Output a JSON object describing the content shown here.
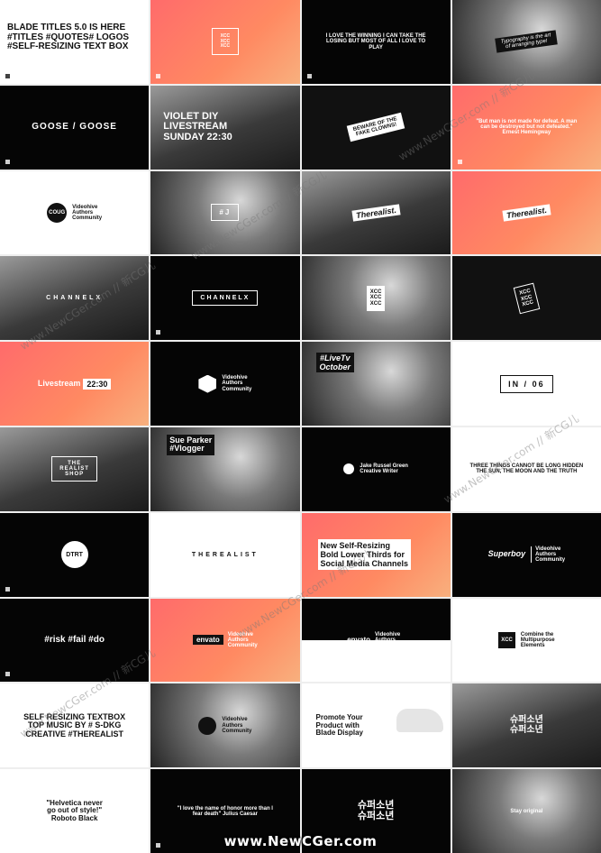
{
  "tiles": [
    {
      "text": "BLADE TITLES 5.0 IS HERE\n#TITLES #QUOTES# LOGOS\n#SELF-RESIZING TEXT BOX"
    },
    {
      "text": "XCC\nXCC\nXCC"
    },
    {
      "text": "I LOVE THE WINNING I CAN TAKE THE LOSING BUT MOST OF ALL I LOVE TO PLAY"
    },
    {
      "text": "Typography is the art of arranging type!"
    },
    {
      "text": "GOOSE / GOOSE"
    },
    {
      "text": "VIOLET DIY\nLIVESTREAM\nSUNDAY 22:30"
    },
    {
      "text": "BEWARE OF THE\nFAKE CLOWNS!"
    },
    {
      "text": "\"But man is not made for defeat. A man can be destroyed but not defeated.\" Ernest Hemingway"
    },
    {
      "logo": "COUG",
      "text": "Videohive\nAuthors\nCommunity"
    },
    {
      "text": "#J"
    },
    {
      "text": "Therealist."
    },
    {
      "text": "Therealist."
    },
    {
      "text": "CHANNELX"
    },
    {
      "text": "CHANNELX"
    },
    {
      "text": "XCC\nXCC\nXCC"
    },
    {
      "text": "XCC\nXCC\nXCC"
    },
    {
      "text": "Livestream",
      "badge": "22:30"
    },
    {
      "text": "Videohive\nAuthors\nCommunity"
    },
    {
      "text": "#LiveTv\nOctober"
    },
    {
      "text": "IN / 06"
    },
    {
      "text": "THE\nREALIST\nSHOP"
    },
    {
      "text": "Sue Parker\n#Vlogger"
    },
    {
      "text": "Jake Russel Green\nCreative Writer"
    },
    {
      "text": "THREE THINGS CANNOT BE LONG HIDDEN\nTHE SUN, THE MOON AND THE TRUTH"
    },
    {
      "text": "DTRT"
    },
    {
      "text": "THEREALIST"
    },
    {
      "text": "New Self-Resizing\nBold Lower Thirds for\nSocial Media Channels"
    },
    {
      "text": "Superboy",
      "sub": "Videohive\nAuthors\nCommunity"
    },
    {
      "text": "#risk #fail #do"
    },
    {
      "text": "envato",
      "sub": "Videohive\nAuthors\nCommunity"
    },
    {
      "text": "envato",
      "sub": "Videohive\nAuthors\nCommunity"
    },
    {
      "text": "XCC",
      "sub": "Combine the\nMultipurpose\nElements"
    },
    {
      "text": "SELF RESIZING TEXTBOX\nTOP MUSIC BY # S-DKG\nCREATIVE #THEREALIST"
    },
    {
      "text": "Videohive\nAuthors\nCommunity"
    },
    {
      "text": "Promote Your\nProduct with\nBlade Display"
    },
    {
      "text": "슈퍼소년\n슈퍼소년"
    },
    {
      "text": "\"Helvetica never\ngo out of style!\"\nRoboto Black"
    },
    {
      "text": "\"I love the name of honor more than I fear death\" Julius Caesar"
    },
    {
      "text": "슈퍼소년\n슈퍼소년"
    },
    {
      "text": "Stay original"
    }
  ],
  "watermark": {
    "main": "www.NewCGer.com",
    "diag": "www.NewCGer.com // 新CG儿"
  }
}
